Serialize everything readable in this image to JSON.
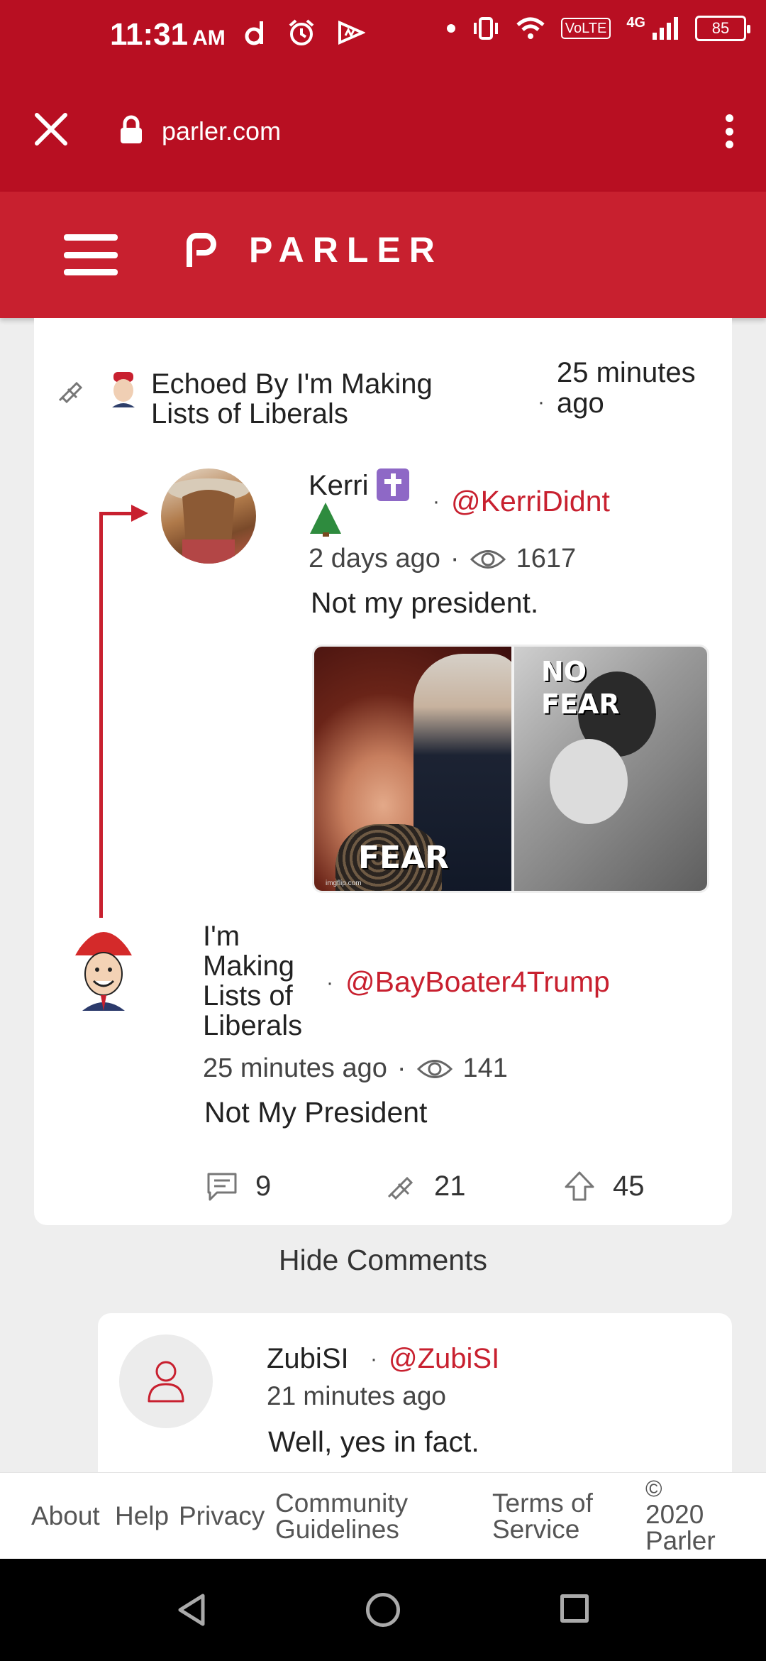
{
  "status_bar": {
    "time": "11:31",
    "am_pm": "AM",
    "volte": "VoLTE",
    "network": "4G",
    "battery": "85"
  },
  "browser": {
    "url": "parler.com"
  },
  "header": {
    "brand": "PARLER"
  },
  "post": {
    "echo_label": "Echoed By I'm Making Lists of Liberals",
    "echo_separator": "·",
    "echo_time": "25 minutes ago",
    "original": {
      "name": "Kerri",
      "separator": "·",
      "handle": "@KerriDidnt",
      "time": "2 days ago",
      "meta_separator": "·",
      "views": "1617",
      "text": "Not my president.",
      "image": {
        "left_caption": "FEAR",
        "right_caption": "NO FEAR",
        "watermark": "imgflip.com"
      }
    },
    "echo": {
      "name": "I'm Making Lists of Liberals",
      "separator": "·",
      "handle": "@BayBoater4Trump",
      "time": "25 minutes ago",
      "meta_separator": "·",
      "views": "141",
      "text": "Not My President"
    },
    "actions": {
      "comments": "9",
      "echoes": "21",
      "upvotes": "45"
    }
  },
  "comments": {
    "toggle_label": "Hide Comments",
    "items": [
      {
        "name": "ZubiSI",
        "separator": "·",
        "handle": "@ZubiSI",
        "time": "21 minutes ago",
        "text": "Well, yes in fact."
      }
    ]
  },
  "footer": {
    "about": "About",
    "help": "Help",
    "privacy": "Privacy",
    "community": "Community Guidelines",
    "terms": "Terms of Service",
    "copyright_symbol": "©",
    "copyright_text": "2020 Parler"
  },
  "colors": {
    "brand_red": "#c8202f",
    "status_red": "#b80f22"
  }
}
